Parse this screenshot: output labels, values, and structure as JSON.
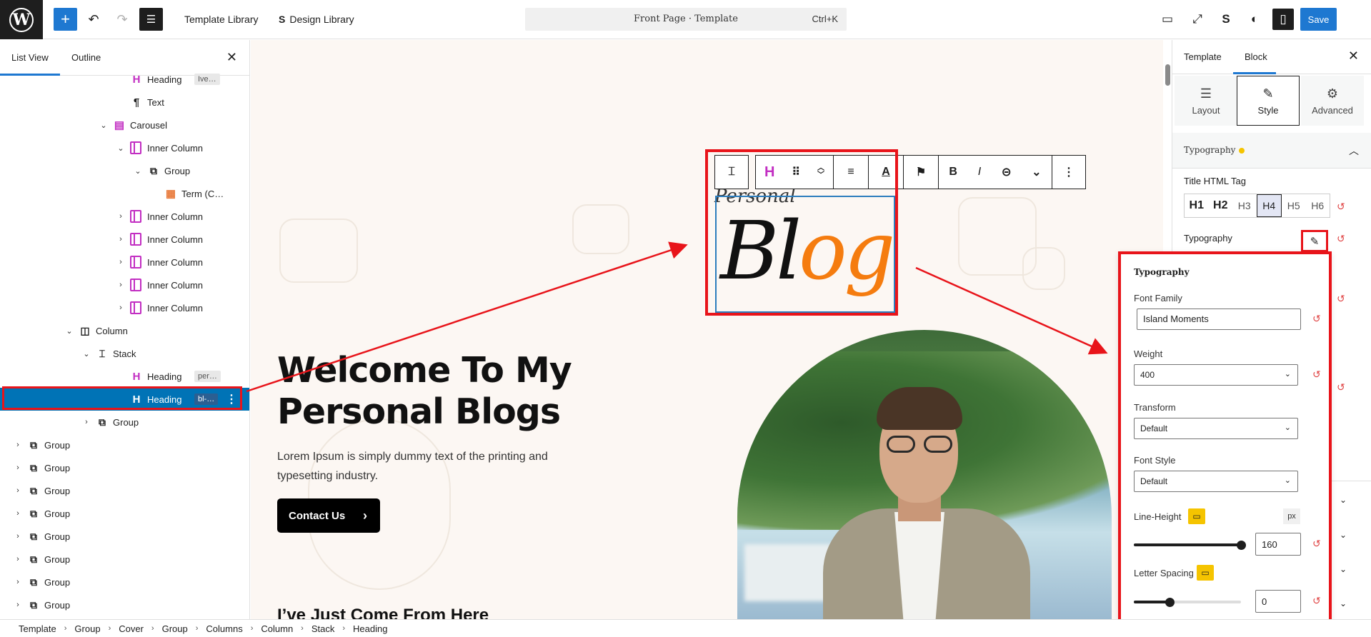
{
  "topbar": {
    "template_library": "Template Library",
    "design_library": "Design Library",
    "command_title": "Front Page · Template",
    "command_shortcut": "Ctrl+K",
    "save_label": "Save"
  },
  "left_panel": {
    "tab_list_view": "List View",
    "tab_outline": "Outline",
    "tree": [
      {
        "label": "Heading",
        "tag": "Ive…",
        "icon": "heading-icon",
        "depth": 7
      },
      {
        "label": "Text",
        "tag": "",
        "icon": "paragraph-icon",
        "depth": 7
      },
      {
        "label": "Carousel",
        "tag": "",
        "icon": "carousel-icon",
        "depth": 6
      },
      {
        "label": "Inner Column",
        "tag": "",
        "icon": "inner-column-icon",
        "depth": 7
      },
      {
        "label": "Group",
        "tag": "",
        "icon": "group-icon",
        "depth": 8
      },
      {
        "label": "Term (C…",
        "tag": "",
        "icon": "term-icon",
        "depth": 9
      },
      {
        "label": "Inner Column",
        "tag": "",
        "icon": "inner-column-icon",
        "depth": 7
      },
      {
        "label": "Inner Column",
        "tag": "",
        "icon": "inner-column-icon",
        "depth": 7
      },
      {
        "label": "Inner Column",
        "tag": "",
        "icon": "inner-column-icon",
        "depth": 7
      },
      {
        "label": "Inner Column",
        "tag": "",
        "icon": "inner-column-icon",
        "depth": 7
      },
      {
        "label": "Inner Column",
        "tag": "",
        "icon": "inner-column-icon",
        "depth": 7
      },
      {
        "label": "Column",
        "tag": "",
        "icon": "column-icon",
        "depth": 4
      },
      {
        "label": "Stack",
        "tag": "",
        "icon": "stack-icon",
        "depth": 5
      },
      {
        "label": "Heading",
        "tag": "per…",
        "icon": "heading-icon",
        "depth": 7
      },
      {
        "label": "Heading",
        "tag": "bl-…",
        "icon": "heading-icon",
        "depth": 7
      },
      {
        "label": "Group",
        "tag": "",
        "icon": "group-icon",
        "depth": 5
      },
      {
        "label": "Group",
        "tag": "",
        "icon": "group-icon",
        "depth": 1
      },
      {
        "label": "Group",
        "tag": "",
        "icon": "group-icon",
        "depth": 1
      },
      {
        "label": "Group",
        "tag": "",
        "icon": "group-icon",
        "depth": 1
      },
      {
        "label": "Group",
        "tag": "",
        "icon": "group-icon",
        "depth": 1
      },
      {
        "label": "Group",
        "tag": "",
        "icon": "group-icon",
        "depth": 1
      },
      {
        "label": "Group",
        "tag": "",
        "icon": "group-icon",
        "depth": 1
      },
      {
        "label": "Group",
        "tag": "",
        "icon": "group-icon",
        "depth": 1
      },
      {
        "label": "Group",
        "tag": "",
        "icon": "group-icon",
        "depth": 1
      }
    ]
  },
  "canvas": {
    "personal_script": "Personal",
    "blog_script_dark": "Bl",
    "blog_script_orange": "og",
    "welcome_line1": "Welcome To My",
    "welcome_line2": "Personal Blogs",
    "lorem": "Lorem Ipsum is simply dummy text of the printing and typesetting industry.",
    "contact_button": "Contact Us",
    "come_from": "I’ve Just Come From Here"
  },
  "right_panel": {
    "tab_template": "Template",
    "tab_block": "Block",
    "sub_layout": "Layout",
    "sub_style": "Style",
    "sub_advanced": "Advanced",
    "section_typography": "Typography",
    "title_html_tag_label": "Title HTML Tag",
    "html_tags": [
      "H1",
      "H2",
      "H3",
      "H4",
      "H5",
      "H6"
    ],
    "active_tag": "H4",
    "typography_row_label": "Typography"
  },
  "typography_popover": {
    "title": "Typography",
    "font_family_label": "Font Family",
    "font_family_value": "Island Moments",
    "weight_label": "Weight",
    "weight_value": "400",
    "transform_label": "Transform",
    "transform_value": "Default",
    "font_style_label": "Font Style",
    "font_style_value": "Default",
    "line_height_label": "Line-Height",
    "line_height_unit": "px",
    "line_height_value": "160",
    "letter_spacing_label": "Letter Spacing",
    "letter_spacing_value": "0"
  },
  "breadcrumb": [
    "Template",
    "Group",
    "Cover",
    "Group",
    "Columns",
    "Column",
    "Stack",
    "Heading"
  ],
  "colors": {
    "accent_blue": "#1e78d1",
    "annotation_red": "#e8141a",
    "selected_row": "#0073b6",
    "heading_icon": "#c22ec2",
    "blog_orange": "#f57c0f",
    "indicator_yellow": "#f5c400"
  }
}
